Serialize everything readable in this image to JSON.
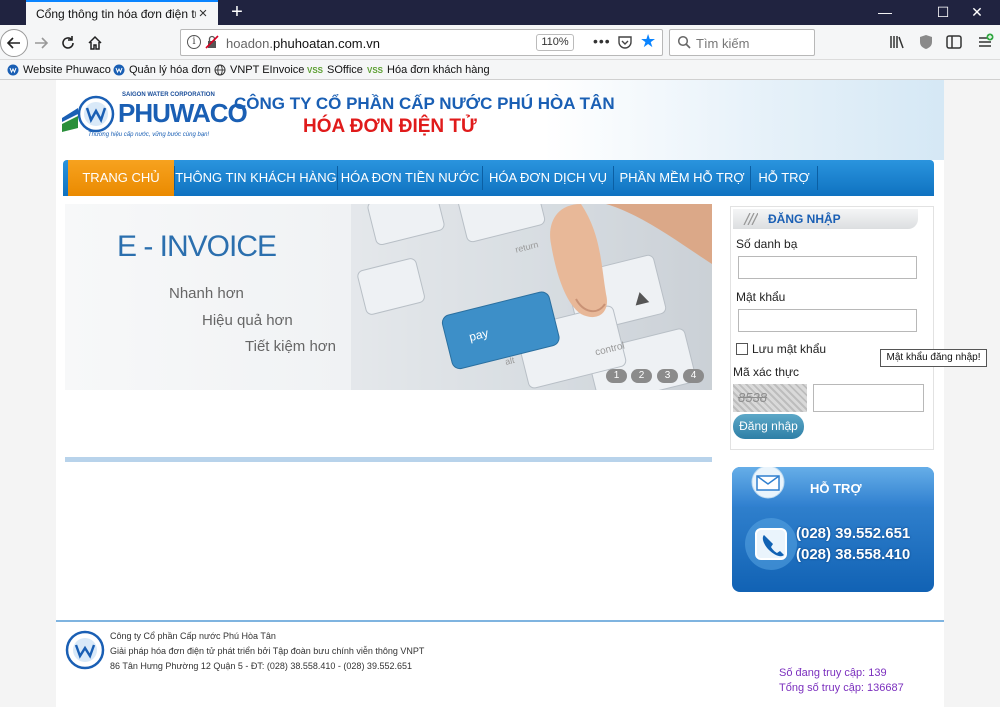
{
  "browser": {
    "tab_title": "Cổng thông tin hóa đơn điện tử",
    "url_host": "hoadon.",
    "url_domain": "phuhoatan.com.vn",
    "zoom": "110%",
    "search_placeholder": "Tìm kiếm",
    "bookmarks": [
      "Website Phuwaco",
      "Quản lý hóa đơn",
      "VNPT EInvoice",
      "SOffice",
      "Hóa đơn khách hàng"
    ],
    "bookmark_badge": "VSS"
  },
  "header": {
    "logo_sub": "SAIGON WATER CORPORATION",
    "logo_name": "PHUWACO",
    "logo_slogan": "Thương hiệu cấp nước, vững bước cùng bạn!",
    "company": "CÔNG TY CỔ PHẦN CẤP NƯỚC PHÚ HÒA TÂN",
    "title": "HÓA ĐƠN ĐIỆN TỬ"
  },
  "menu": [
    "TRANG CHỦ",
    "THÔNG TIN KHÁCH HÀNG",
    "HÓA ĐƠN TIỀN NƯỚC",
    "HÓA ĐƠN DỊCH VỤ",
    "PHẦN MỀM HỖ TRỢ",
    "HỖ TRỢ"
  ],
  "banner": {
    "headline": "E - INVOICE",
    "lines": [
      "Nhanh hơn",
      "Hiệu quả hơn",
      "Tiết kiệm hơn"
    ],
    "keys": [
      "pay",
      "control",
      "return",
      "alt"
    ],
    "dots": [
      "1",
      "2",
      "3",
      "4"
    ]
  },
  "login": {
    "heading": "ĐĂNG NHẬP",
    "username_label": "Số danh bạ",
    "password_label": "Mật khẩu",
    "remember_label": "Lưu mật khẩu",
    "captcha_label": "Mã xác thực",
    "captcha_text": "8538",
    "submit": "Đăng nhập"
  },
  "tooltip": "Mật khẩu đăng nhập!",
  "support": {
    "title": "HỖ TRỢ",
    "phones": [
      "(028) 39.552.651",
      "(028) 38.558.410"
    ]
  },
  "footer": {
    "company": "Công ty Cổ phần Cấp nước Phú Hòa Tân",
    "solution": "Giải pháp hóa đơn điện tử phát triển bởi Tập đoàn bưu chính viễn thông VNPT",
    "address": "86 Tân Hưng Phường 12 Quận 5 - ĐT: (028) 38.558.410 - (028) 39.552.651",
    "online": "Số đang truy cập: 139",
    "total": "Tổng số truy cập: 136687"
  },
  "colors": {
    "primary_blue": "#1a5fb4",
    "menu_blue": "#2a94de",
    "menu_active": "#f7a21f",
    "title_red": "#e01b1b",
    "visits_purple": "#7b2fbe"
  }
}
